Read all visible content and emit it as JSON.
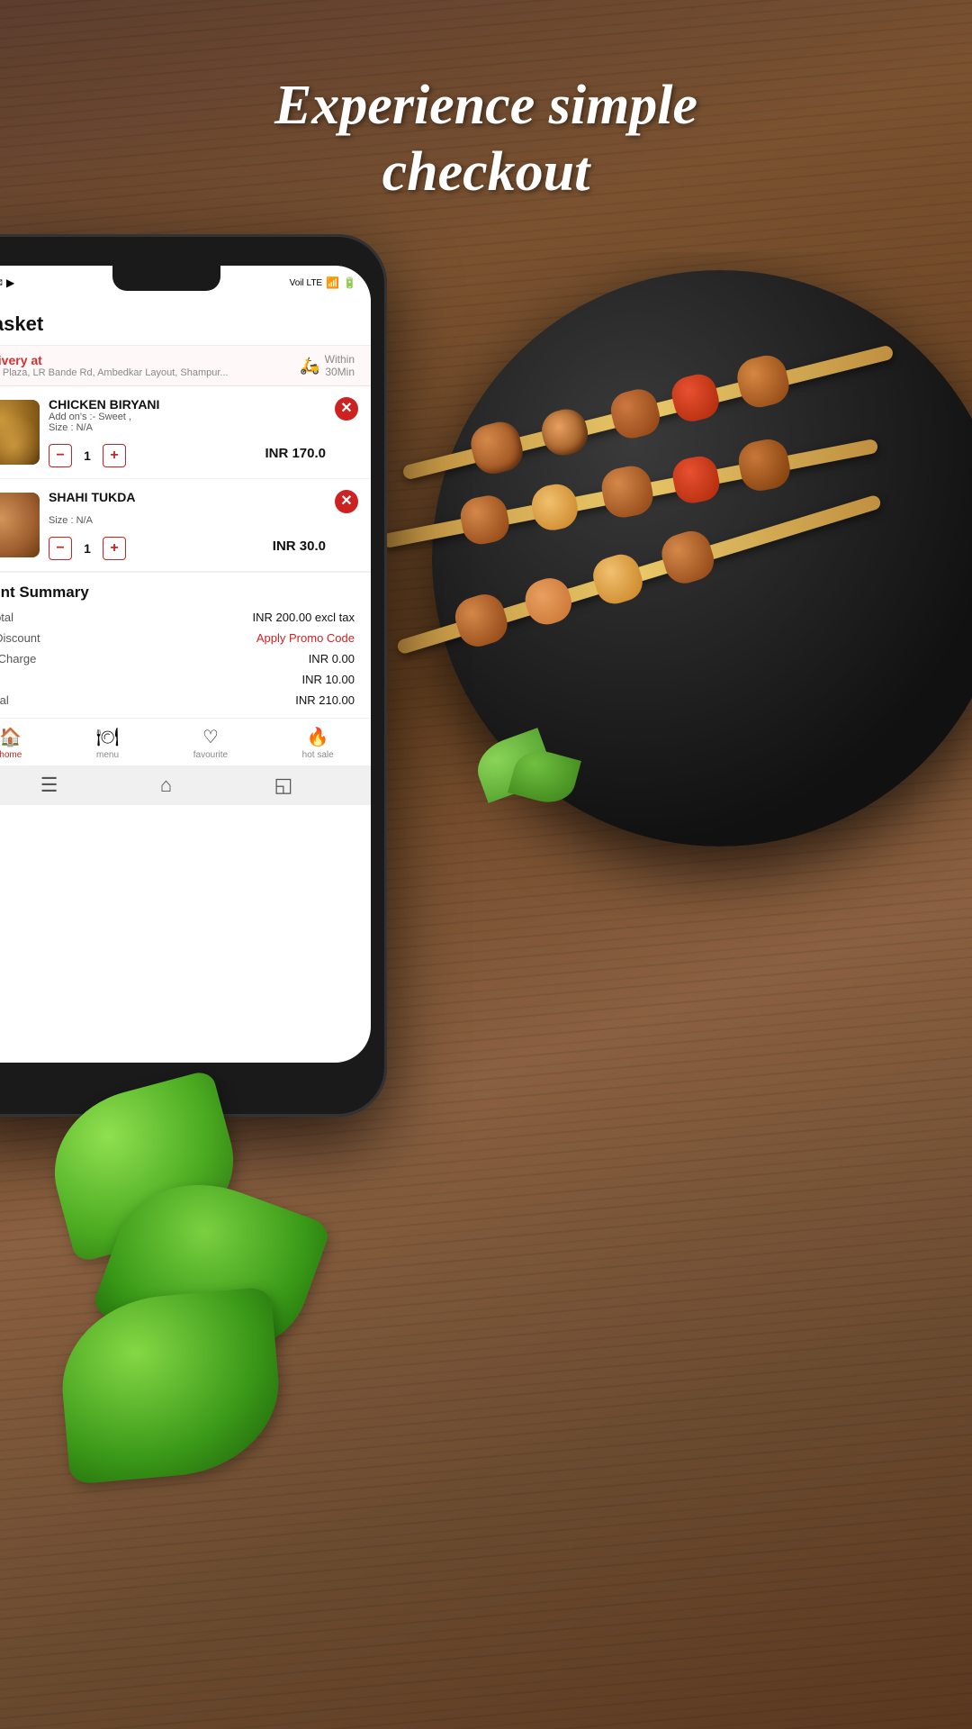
{
  "background": {
    "color_top": "#5c3d2e",
    "color_bottom": "#4a2e18"
  },
  "headline": {
    "line1": "Experience simple",
    "line2": "checkout"
  },
  "phone": {
    "status_bar": {
      "left_icons": "📱✉️📷",
      "signal": "Voil LTE",
      "wifi": "WiFi",
      "battery": "🔋"
    },
    "header": {
      "title": "Basket"
    },
    "delivery": {
      "label": "Delivery at",
      "address": "GVR Plaza, LR Bande Rd, Ambedkar Layout, Shampur...",
      "within_label": "Within",
      "time": "30Min"
    },
    "cart_items": [
      {
        "id": 1,
        "name": "CHICKEN BIRYANI",
        "addons": "Add on's :- Sweet ,",
        "size": "Size :  N/A",
        "quantity": 1,
        "price": "INR 170.0"
      },
      {
        "id": 2,
        "name": "SHAHI TUKDA",
        "addons": "",
        "size": "Size :  N/A",
        "quantity": 1,
        "price": "INR 30.0"
      }
    ],
    "payment_summary": {
      "title": "ment Summary",
      "rows": [
        {
          "label": "et total",
          "value": "INR 200.00 excl tax",
          "red": false
        },
        {
          "label": "on Discount",
          "value": "Apply Promo Code",
          "red": true
        },
        {
          "label": "ery Charge",
          "value": "INR 0.00",
          "red": false
        },
        {
          "label": "%)",
          "value": "INR 10.00",
          "red": false
        },
        {
          "label": "l Total",
          "value": "INR 210.00",
          "red": false
        }
      ]
    },
    "bottom_nav": [
      {
        "icon": "🏠",
        "label": "home",
        "active": true
      },
      {
        "icon": "🍽",
        "label": "menu",
        "active": false
      },
      {
        "icon": "❤",
        "label": "favourite",
        "active": false
      },
      {
        "icon": "🔥",
        "label": "hot sale",
        "active": false
      }
    ],
    "gesture_bar": {
      "menu_icon": "☰",
      "home_icon": "⌂",
      "back_icon": "◱"
    }
  }
}
